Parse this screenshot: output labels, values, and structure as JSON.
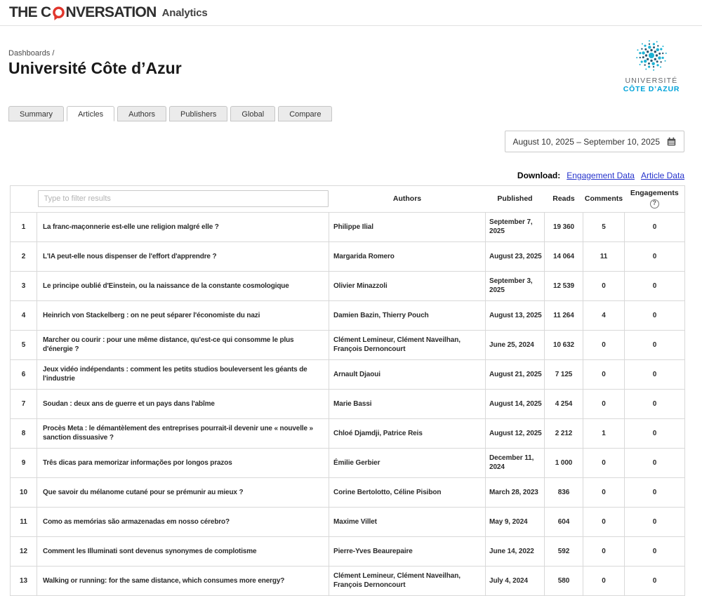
{
  "colors": {
    "brand_red": "#e1362c",
    "uca_cyan": "#1cb2d4",
    "uca_navy": "#2b5871",
    "uca_text_blue": "#00a3d9",
    "link_blue": "#2633cc"
  },
  "topbar": {
    "brand_part1": "THE C",
    "brand_part2": "NVERSATION",
    "brand_suffix": "Analytics"
  },
  "breadcrumb": "Dashboards /",
  "page_title": "Université Côte d’Azur",
  "org_logo": {
    "line1": "UNIVERSITÉ",
    "line2": "CÔTE D’AZUR"
  },
  "tabs": [
    {
      "label": "Summary",
      "active": false
    },
    {
      "label": "Articles",
      "active": true
    },
    {
      "label": "Authors",
      "active": false
    },
    {
      "label": "Publishers",
      "active": false
    },
    {
      "label": "Global",
      "active": false
    },
    {
      "label": "Compare",
      "active": false
    }
  ],
  "date_range": {
    "value": "August 10, 2025 – September 10, 2025"
  },
  "download": {
    "label": "Download:",
    "links": [
      "Engagement Data",
      "Article Data"
    ]
  },
  "table": {
    "filter_placeholder": "Type to filter results",
    "columns": {
      "authors": "Authors",
      "published": "Published",
      "reads": "Reads",
      "comments": "Comments",
      "engagements": "Engagements"
    },
    "help_glyph": "?",
    "rows": [
      {
        "rank": "1",
        "title": "La franc-maçonnerie est-elle une religion malgré elle ?",
        "authors": "Philippe Ilial",
        "published": "September 7, 2025",
        "reads": "19 360",
        "comments": "5",
        "engagements": "0"
      },
      {
        "rank": "2",
        "title": "L'IA peut-elle nous dispenser de l'effort d'apprendre ?",
        "authors": "Margarida Romero",
        "published": "August 23, 2025",
        "reads": "14 064",
        "comments": "11",
        "engagements": "0"
      },
      {
        "rank": "3",
        "title": "Le principe oublié d'Einstein, ou la naissance de la constante cosmologique",
        "authors": "Olivier Minazzoli",
        "published": "September 3, 2025",
        "reads": "12 539",
        "comments": "0",
        "engagements": "0"
      },
      {
        "rank": "4",
        "title": "Heinrich von Stackelberg : on ne peut séparer l'économiste du nazi",
        "authors": "Damien Bazin, Thierry Pouch",
        "published": "August 13, 2025",
        "reads": "11 264",
        "comments": "4",
        "engagements": "0"
      },
      {
        "rank": "5",
        "title": "Marcher ou courir : pour une même distance, qu'est-ce qui consomme le plus d'énergie ?",
        "authors": "Clément Lemineur, Clément Naveilhan, François Dernoncourt",
        "published": "June 25, 2024",
        "reads": "10 632",
        "comments": "0",
        "engagements": "0"
      },
      {
        "rank": "6",
        "title": "Jeux vidéo indépendants : comment les petits studios bouleversent les géants de l'industrie",
        "authors": "Arnault Djaoui",
        "published": "August 21, 2025",
        "reads": "7 125",
        "comments": "0",
        "engagements": "0"
      },
      {
        "rank": "7",
        "title": "Soudan : deux ans de guerre et un pays dans l'abîme",
        "authors": "Marie Bassi",
        "published": "August 14, 2025",
        "reads": "4 254",
        "comments": "0",
        "engagements": "0"
      },
      {
        "rank": "8",
        "title": "Procès Meta : le démantèlement des entreprises pourrait-il devenir une « nouvelle » sanction dissuasive ?",
        "authors": "Chloé Djamdji, Patrice Reis",
        "published": "August 12, 2025",
        "reads": "2 212",
        "comments": "1",
        "engagements": "0"
      },
      {
        "rank": "9",
        "title": "Três dicas para memorizar informações por longos prazos",
        "authors": "Émilie Gerbier",
        "published": "December 11, 2024",
        "reads": "1 000",
        "comments": "0",
        "engagements": "0"
      },
      {
        "rank": "10",
        "title": "Que savoir du mélanome cutané pour se prémunir au mieux ?",
        "authors": "Corine Bertolotto, Céline Pisibon",
        "published": "March 28, 2023",
        "reads": "836",
        "comments": "0",
        "engagements": "0"
      },
      {
        "rank": "11",
        "title": "Como as memórias são armazenadas em nosso cérebro?",
        "authors": "Maxime Villet",
        "published": "May 9, 2024",
        "reads": "604",
        "comments": "0",
        "engagements": "0"
      },
      {
        "rank": "12",
        "title": "Comment les Illuminati sont devenus synonymes de complotisme",
        "authors": "Pierre-Yves Beaurepaire",
        "published": "June 14, 2022",
        "reads": "592",
        "comments": "0",
        "engagements": "0"
      },
      {
        "rank": "13",
        "title": "Walking or running: for the same distance, which consumes more energy?",
        "authors": "Clément Lemineur, Clément Naveilhan, François Dernoncourt",
        "published": "July 4, 2024",
        "reads": "580",
        "comments": "0",
        "engagements": "0"
      }
    ]
  }
}
